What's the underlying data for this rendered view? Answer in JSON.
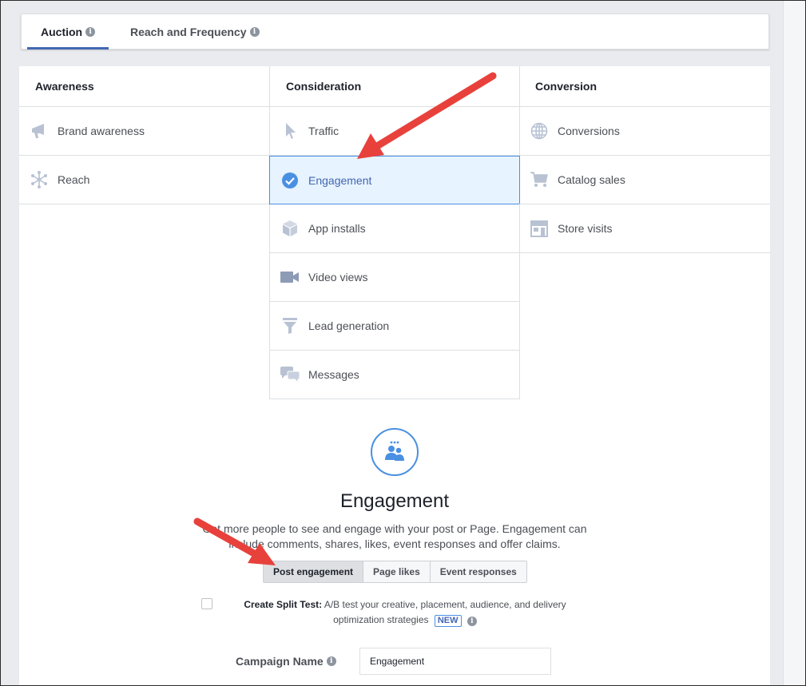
{
  "tabs": [
    {
      "label": "Auction",
      "active": true
    },
    {
      "label": "Reach and Frequency",
      "active": false
    }
  ],
  "columns": [
    {
      "header": "Awareness",
      "items": [
        {
          "label": "Brand awareness",
          "icon": "megaphone-icon"
        },
        {
          "label": "Reach",
          "icon": "reach-icon"
        }
      ]
    },
    {
      "header": "Consideration",
      "items": [
        {
          "label": "Traffic",
          "icon": "cursor-icon"
        },
        {
          "label": "Engagement",
          "icon": "check-circle-icon",
          "selected": true
        },
        {
          "label": "App installs",
          "icon": "box-icon"
        },
        {
          "label": "Video views",
          "icon": "video-camera-icon"
        },
        {
          "label": "Lead generation",
          "icon": "funnel-icon"
        },
        {
          "label": "Messages",
          "icon": "chat-bubbles-icon"
        }
      ]
    },
    {
      "header": "Conversion",
      "items": [
        {
          "label": "Conversions",
          "icon": "globe-icon"
        },
        {
          "label": "Catalog sales",
          "icon": "cart-icon"
        },
        {
          "label": "Store visits",
          "icon": "store-icon"
        }
      ]
    }
  ],
  "detail": {
    "title": "Engagement",
    "description": "Get more people to see and engage with your post or Page. Engagement can include comments, shares, likes, event responses and offer claims.",
    "icon": "people-icon",
    "subtabs": [
      {
        "label": "Post engagement",
        "active": true
      },
      {
        "label": "Page likes",
        "active": false
      },
      {
        "label": "Event responses",
        "active": false
      }
    ]
  },
  "split_test": {
    "label": "Create Split Test:",
    "text": "A/B test your creative, placement, audience, and delivery optimization strategies",
    "badge": "NEW",
    "checked": false
  },
  "campaign": {
    "label": "Campaign Name",
    "value": "Engagement"
  },
  "colors": {
    "accent": "#4267b2",
    "selected_bg": "#e7f3ff",
    "arrow": "#e8413c"
  }
}
